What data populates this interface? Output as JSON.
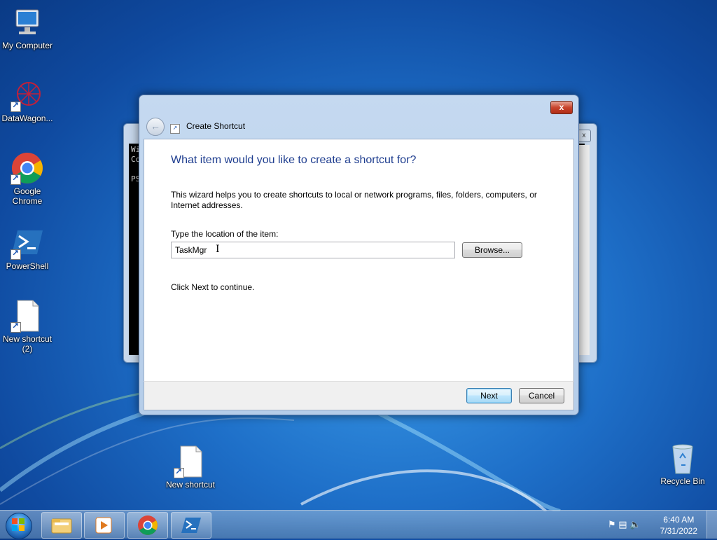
{
  "desktop": {
    "icons": [
      {
        "label": "My Computer"
      },
      {
        "label": "DataWagon..."
      },
      {
        "label": "Google Chrome"
      },
      {
        "label": "PowerShell"
      },
      {
        "label": "New shortcut (2)"
      },
      {
        "label": "New shortcut"
      },
      {
        "label": "Recycle Bin"
      }
    ]
  },
  "console": {
    "lines": [
      "Wi",
      "Co",
      "",
      "PS"
    ],
    "close_label": "x"
  },
  "wizard": {
    "title": "Create Shortcut",
    "close_label": "x",
    "heading": "What item would you like to create a shortcut for?",
    "description": "This wizard helps you to create shortcuts to local or network programs, files, folders, computers, or Internet addresses.",
    "location_label": "Type the location of the item:",
    "location_value": "TaskMgr",
    "browse_label": "Browse...",
    "continue_text": "Click Next to continue.",
    "next_label": "Next",
    "cancel_label": "Cancel"
  },
  "taskbar": {
    "items": [
      "file-explorer",
      "media-player",
      "google-chrome",
      "powershell"
    ],
    "clock_time": "6:40 AM",
    "clock_date": "7/31/2022"
  },
  "colors": {
    "heading": "#1e3d8f",
    "desktop": "#1e6fc8"
  }
}
